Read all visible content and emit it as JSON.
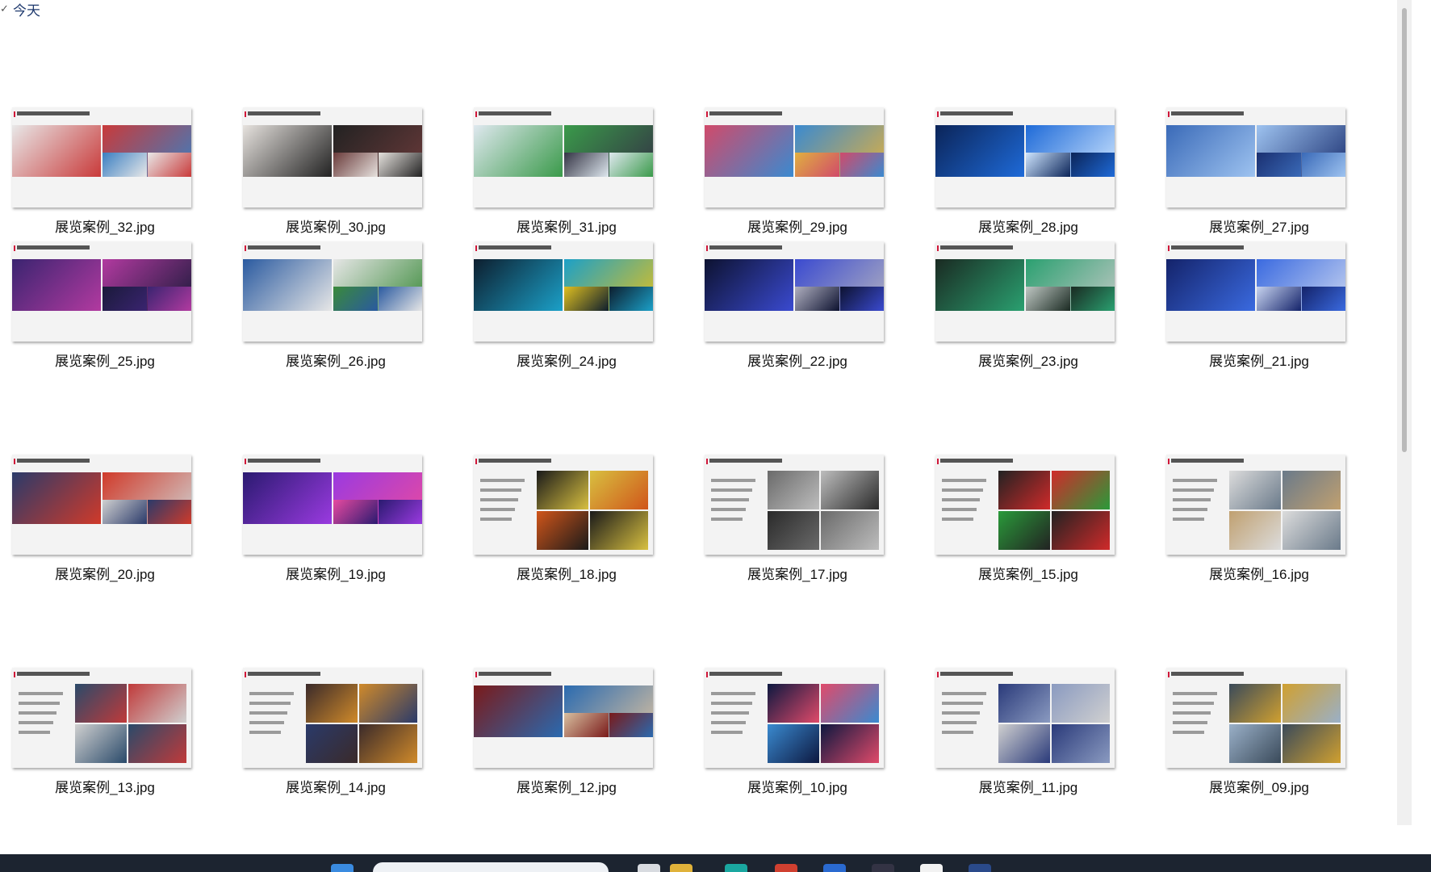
{
  "group": {
    "label": "今天"
  },
  "files": [
    {
      "name": "展览案例_32.jpg",
      "theme": "stats"
    },
    {
      "name": "展览案例_30.jpg",
      "theme": "doc"
    },
    {
      "name": "展览案例_31.jpg",
      "theme": "map"
    },
    {
      "name": "展览案例_29.jpg",
      "theme": "colorful"
    },
    {
      "name": "展览案例_28.jpg",
      "theme": "blue"
    },
    {
      "name": "展览案例_27.jpg",
      "theme": "blue2"
    },
    {
      "name": "展览案例_25.jpg",
      "theme": "purple"
    },
    {
      "name": "展览案例_26.jpg",
      "theme": "booth"
    },
    {
      "name": "展览案例_24.jpg",
      "theme": "darkteal"
    },
    {
      "name": "展览案例_22.jpg",
      "theme": "darkblue"
    },
    {
      "name": "展览案例_23.jpg",
      "theme": "green"
    },
    {
      "name": "展览案例_21.jpg",
      "theme": "blue3"
    },
    {
      "name": "展览案例_20.jpg",
      "theme": "mixed"
    },
    {
      "name": "展览案例_19.jpg",
      "theme": "violet"
    },
    {
      "name": "展览案例_18.jpg",
      "theme": "dark"
    },
    {
      "name": "展览案例_17.jpg",
      "theme": "grey"
    },
    {
      "name": "展览案例_15.jpg",
      "theme": "circles"
    },
    {
      "name": "展览案例_16.jpg",
      "theme": "white"
    },
    {
      "name": "展览案例_13.jpg",
      "theme": "sidetext"
    },
    {
      "name": "展览案例_14.jpg",
      "theme": "sidetext2"
    },
    {
      "name": "展览案例_12.jpg",
      "theme": "crowd"
    },
    {
      "name": "展览案例_10.jpg",
      "theme": "sidetext3"
    },
    {
      "name": "展览案例_11.jpg",
      "theme": "sidetext4"
    },
    {
      "name": "展览案例_09.jpg",
      "theme": "sidetext5"
    }
  ],
  "colors": {
    "header_text": "#1f3a6e",
    "accent_red": "#d0183a",
    "taskbar": "#1c2430"
  }
}
